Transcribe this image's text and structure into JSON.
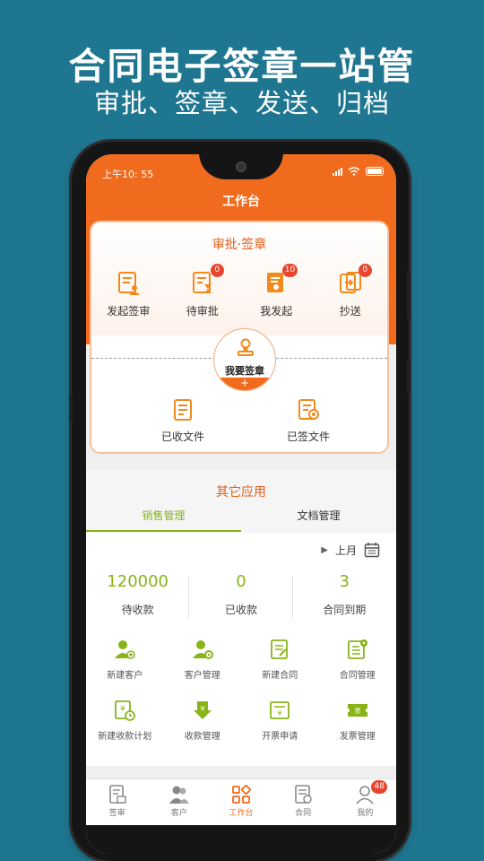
{
  "promo": {
    "title": "合同电子签章一站管",
    "subtitle": "审批、签章、发送、归档"
  },
  "status_bar": {
    "time": "上午10: 55"
  },
  "header": {
    "title": "工作台"
  },
  "approval": {
    "title": "审批·签章",
    "items": [
      {
        "label": "发起签审",
        "icon": "document-person-icon",
        "badge": null
      },
      {
        "label": "待审批",
        "icon": "document-hourglass-icon",
        "badge": "0"
      },
      {
        "label": "我发起",
        "icon": "document-user-icon",
        "badge": "10"
      },
      {
        "label": "抄送",
        "icon": "forward-copy-icon",
        "badge": "0"
      }
    ],
    "stamp_button": {
      "label": "我要签章",
      "plus": "+"
    },
    "files": [
      {
        "label": "已收文件",
        "icon": "received-file-icon"
      },
      {
        "label": "已签文件",
        "icon": "signed-file-icon"
      }
    ]
  },
  "other": {
    "title": "其它应用",
    "tabs": [
      {
        "label": "销售管理",
        "active": true
      },
      {
        "label": "文档管理",
        "active": false
      }
    ],
    "period": "上月",
    "stats": [
      {
        "value": "120000",
        "label": "待收款"
      },
      {
        "value": "0",
        "label": "已收款"
      },
      {
        "value": "3",
        "label": "合同到期"
      }
    ],
    "apps_row1": [
      {
        "label": "新建客户",
        "icon": "add-customer-icon"
      },
      {
        "label": "客户管理",
        "icon": "customer-settings-icon"
      },
      {
        "label": "新建合同",
        "icon": "new-contract-icon"
      },
      {
        "label": "合同管理",
        "icon": "contract-settings-icon"
      }
    ],
    "apps_row2": [
      {
        "label": "新建收款计划",
        "icon": "payment-plan-icon"
      },
      {
        "label": "收款管理",
        "icon": "collection-icon"
      },
      {
        "label": "开票申请",
        "icon": "invoice-request-icon"
      },
      {
        "label": "发票管理",
        "icon": "invoice-ticket-icon"
      }
    ]
  },
  "tabbar": [
    {
      "label": "签审",
      "icon": "review-icon",
      "active": false,
      "badge": null
    },
    {
      "label": "客户",
      "icon": "customers-icon",
      "active": false,
      "badge": null
    },
    {
      "label": "工作台",
      "icon": "workbench-icon",
      "active": true,
      "badge": null
    },
    {
      "label": "合同",
      "icon": "contract-icon",
      "active": false,
      "badge": null
    },
    {
      "label": "我的",
      "icon": "profile-icon",
      "active": false,
      "badge": "48"
    }
  ],
  "colors": {
    "background": "#1f7690",
    "header_orange": "#f06b1d",
    "accent_green": "#88b418",
    "badge_red": "#e8452e"
  }
}
